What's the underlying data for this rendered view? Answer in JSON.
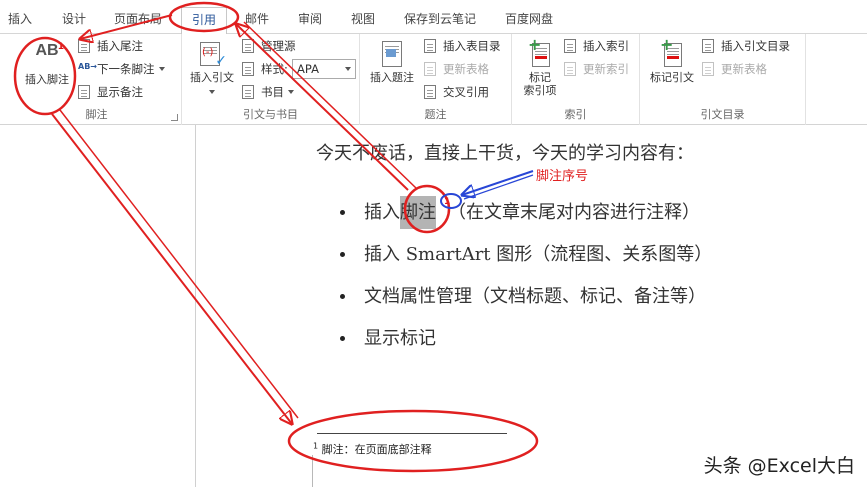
{
  "tabs": [
    {
      "label": "插入"
    },
    {
      "label": "设计"
    },
    {
      "label": "页面布局"
    },
    {
      "label": "引用",
      "active": true
    },
    {
      "label": "邮件"
    },
    {
      "label": "审阅"
    },
    {
      "label": "视图"
    },
    {
      "label": "保存到云笔记"
    },
    {
      "label": "百度网盘"
    }
  ],
  "ribbon": {
    "footnote_group": {
      "label": "脚注",
      "insert_footnote": "插入脚注",
      "ab_icon_text": "AB",
      "ab_icon_sup": "1",
      "insert_endnote": "插入尾注",
      "next_footnote": "下一条脚注",
      "show_notes": "显示备注"
    },
    "citation_group": {
      "label": "引文与书目",
      "insert_citation": "插入引文",
      "manage_sources": "管理源",
      "style_label": "样式:",
      "style_value": "APA",
      "bibliography": "书目"
    },
    "caption_group": {
      "label": "题注",
      "insert_caption": "插入题注",
      "insert_table_of_figures": "插入表目录",
      "update_table": "更新表格",
      "cross_reference": "交叉引用"
    },
    "index_group": {
      "label": "索引",
      "mark_entry_line1": "标记",
      "mark_entry_line2": "索引项",
      "insert_index": "插入索引",
      "update_index": "更新索引"
    },
    "toa_group": {
      "label": "引文目录",
      "mark_citation": "标记引文",
      "insert_toa": "插入引文目录",
      "update_table": "更新表格"
    }
  },
  "document": {
    "intro": "今天不废话，直接上干货，今天的学习内容有：",
    "bullets": [
      {
        "text_before": "插入",
        "highlight": "脚注",
        "ref": "1",
        "text_after": "（在文章末尾对内容进行注释）"
      },
      {
        "text": "插入 SmartArt 图形（流程图、关系图等）"
      },
      {
        "text": "文档属性管理（文档标题、标记、备注等）"
      },
      {
        "text": "显示标记"
      }
    ],
    "annotation_label": "脚注序号",
    "footnote": {
      "num": "1",
      "text": "脚注：在页面底部注释"
    }
  },
  "watermark": "头条 @Excel大白",
  "colors": {
    "annotation": "#e02020",
    "annotation_blue": "#2846d6",
    "accent": "#2b579a"
  }
}
